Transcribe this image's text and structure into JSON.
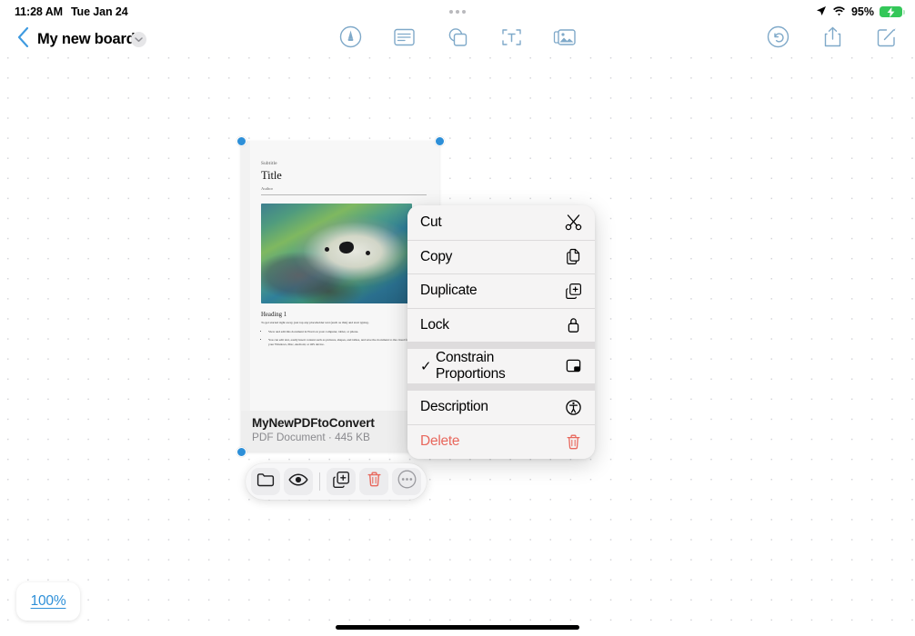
{
  "status_bar": {
    "time": "11:28 AM",
    "date": "Tue Jan 24",
    "battery_percent": "95%",
    "location_icon": "location-arrow-icon",
    "wifi_icon": "wifi-icon",
    "battery_icon": "battery-charging-icon",
    "multitask_icon": "multitasking-dots-icon"
  },
  "nav_bar": {
    "back_icon": "chevron-left-icon",
    "board_title": "My new board",
    "title_chevron_icon": "chevron-down-icon",
    "center_tools": [
      {
        "name": "marker-tool",
        "icon": "marker-circle-icon"
      },
      {
        "name": "note-tool",
        "icon": "sticky-note-icon"
      },
      {
        "name": "shape-tool",
        "icon": "shapes-icon"
      },
      {
        "name": "text-tool",
        "icon": "text-box-icon"
      },
      {
        "name": "media-tool",
        "icon": "photos-icon"
      }
    ],
    "right_tools": [
      {
        "name": "undo-button",
        "icon": "undo-arrow-icon"
      },
      {
        "name": "share-button",
        "icon": "share-up-icon"
      },
      {
        "name": "compose-button",
        "icon": "compose-pencil-icon"
      }
    ]
  },
  "document_card": {
    "page": {
      "subtitle": "Subtitle",
      "title": "Title",
      "author": "Author",
      "heading": "Heading 1",
      "body": "To get started right away, just tap any placeholder text (such as this) and start typing.",
      "bullets": [
        "View and edit this document in Word on your computer, tablet, or phone.",
        "You can edit text, easily insert content such as pictures, shapes, and tables, and save the document to the cloud from Word on your Windows, Mac, Android, or iOS device."
      ],
      "photo_alt": "sea-otter-photo"
    },
    "file_name": "MyNewPDFtoConvert",
    "file_meta": "PDF Document · 445 KB",
    "selection_handles": [
      "top-left",
      "top-right",
      "bottom-left"
    ]
  },
  "context_menu": {
    "items": [
      {
        "label": "Cut",
        "icon": "scissors-icon",
        "name": "menu-item-cut",
        "checked": false,
        "destructive": false,
        "gap_after": false
      },
      {
        "label": "Copy",
        "icon": "copy-documents-icon",
        "name": "menu-item-copy",
        "checked": false,
        "destructive": false,
        "gap_after": false
      },
      {
        "label": "Duplicate",
        "icon": "duplicate-plus-icon",
        "name": "menu-item-duplicate",
        "checked": false,
        "destructive": false,
        "gap_after": false
      },
      {
        "label": "Lock",
        "icon": "lock-icon",
        "name": "menu-item-lock",
        "checked": false,
        "destructive": false,
        "gap_after": true
      },
      {
        "label": "Constrain Proportions",
        "icon": "aspect-ratio-icon",
        "name": "menu-item-constrain-proportions",
        "checked": true,
        "destructive": false,
        "gap_after": true
      },
      {
        "label": "Description",
        "icon": "accessibility-icon",
        "name": "menu-item-description",
        "checked": false,
        "destructive": false,
        "gap_after": false
      },
      {
        "label": "Delete",
        "icon": "trash-icon",
        "name": "menu-item-delete",
        "checked": false,
        "destructive": true,
        "gap_after": false
      }
    ],
    "checkmark": "✓"
  },
  "float_toolbar": {
    "buttons": [
      {
        "name": "folder-button",
        "icon": "folder-icon"
      },
      {
        "name": "preview-button",
        "icon": "eye-icon"
      },
      {
        "name": "duplicate-button",
        "icon": "duplicate-plus-icon"
      },
      {
        "name": "delete-button",
        "icon": "trash-icon"
      },
      {
        "name": "more-button",
        "icon": "ellipsis-circle-icon"
      }
    ]
  },
  "zoom_control": {
    "value": "100%"
  },
  "colors": {
    "accent_blue": "#2d8fd8",
    "tool_blue": "#7fa9c9",
    "destructive_red": "#e8685d",
    "trash_red": "#e8685d",
    "battery_green": "#34c759",
    "canvas_dot": "#d4d4d8"
  }
}
